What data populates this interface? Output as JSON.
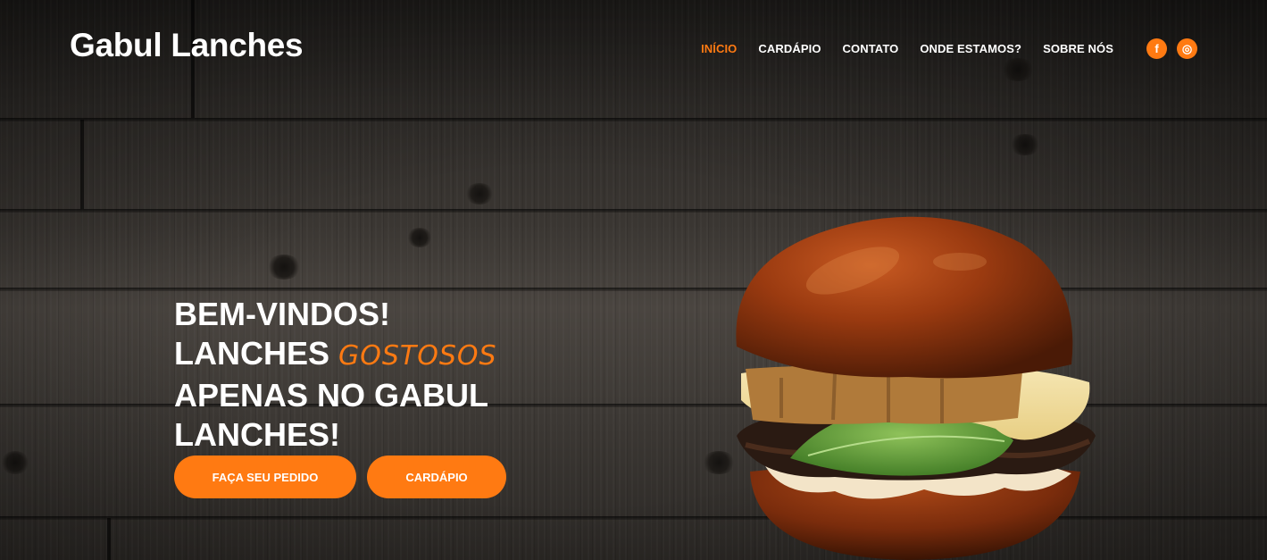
{
  "brand": {
    "name": "Gabul Lanches"
  },
  "nav": {
    "items": [
      {
        "label": "INÍCIO",
        "active": true
      },
      {
        "label": "CARDÁPIO",
        "active": false
      },
      {
        "label": "CONTATO",
        "active": false
      },
      {
        "label": "ONDE ESTAMOS?",
        "active": false
      },
      {
        "label": "SOBRE NÓS",
        "active": false
      }
    ],
    "social": [
      {
        "icon": "facebook-icon",
        "glyph": "f"
      },
      {
        "icon": "instagram-icon",
        "glyph": "◎"
      }
    ]
  },
  "hero": {
    "line1": "BEM-VINDOS!",
    "line2_start": "LANCHES ",
    "line2_accent": "GOSTOSOS",
    "line3": "APENAS NO GABUL",
    "line4": "LANCHES!",
    "order_button": "FAÇA SEU PEDIDO",
    "menu_button": "CARDÁPIO"
  },
  "colors": {
    "accent": "#ff7a12",
    "text": "#ffffff",
    "background": "#2e2b28"
  }
}
